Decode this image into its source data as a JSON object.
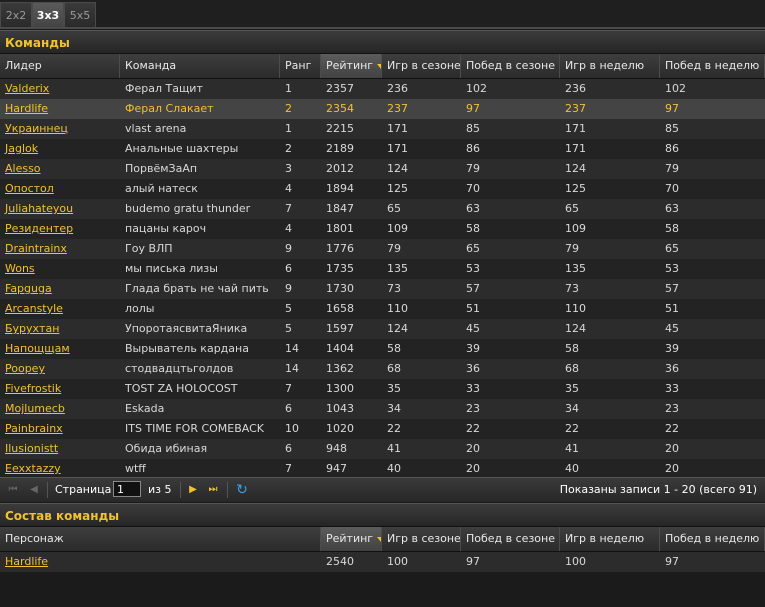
{
  "tabs": [
    "2x2",
    "3x3",
    "5x5"
  ],
  "teams_panel": {
    "title": "Команды",
    "columns": [
      "Лидер",
      "Команда",
      "Ранг",
      "Рейтинг",
      "Игр в сезоне",
      "Побед в сезоне",
      "Игр в неделю",
      "Побед в неделю"
    ],
    "rows": [
      [
        "Valderix",
        "Ферал Тащит",
        "1",
        "2357",
        "236",
        "102",
        "236",
        "102"
      ],
      [
        "Hardlife",
        "Ферал Слакает",
        "2",
        "2354",
        "237",
        "97",
        "237",
        "97"
      ],
      [
        "Украиннец",
        "vlast arena",
        "1",
        "2215",
        "171",
        "85",
        "171",
        "85"
      ],
      [
        "Jaglok",
        "Анальные шахтеры",
        "2",
        "2189",
        "171",
        "86",
        "171",
        "86"
      ],
      [
        "Alesso",
        "ПорвёмЗаАп",
        "3",
        "2012",
        "124",
        "79",
        "124",
        "79"
      ],
      [
        "Опостол",
        "алый натеск",
        "4",
        "1894",
        "125",
        "70",
        "125",
        "70"
      ],
      [
        "Juliahateyou",
        "budemo gratu thunder",
        "7",
        "1847",
        "65",
        "63",
        "65",
        "63"
      ],
      [
        "Резидентер",
        "пацаны кароч",
        "4",
        "1801",
        "109",
        "58",
        "109",
        "58"
      ],
      [
        "Draintrainx",
        "Гоу ВЛП",
        "9",
        "1776",
        "79",
        "65",
        "79",
        "65"
      ],
      [
        "Wons",
        "мы писька лизы",
        "6",
        "1735",
        "135",
        "53",
        "135",
        "53"
      ],
      [
        "Fapguga",
        "Глада брать не чай пить",
        "9",
        "1730",
        "73",
        "57",
        "73",
        "57"
      ],
      [
        "Arcanstyle",
        "лолы",
        "5",
        "1658",
        "110",
        "51",
        "110",
        "51"
      ],
      [
        "Бурухтан",
        "УпоротаясвитаЯника",
        "5",
        "1597",
        "124",
        "45",
        "124",
        "45"
      ],
      [
        "Напощщам",
        "Вырыватель кардана",
        "14",
        "1404",
        "58",
        "39",
        "58",
        "39"
      ],
      [
        "Poopey",
        "стодвадцтьголдов",
        "14",
        "1362",
        "68",
        "36",
        "68",
        "36"
      ],
      [
        "Fivefrostik",
        "TOST ZA HOLOCOST",
        "7",
        "1300",
        "35",
        "33",
        "35",
        "33"
      ],
      [
        "Mojlumecb",
        "Eskada",
        "6",
        "1043",
        "34",
        "23",
        "34",
        "23"
      ],
      [
        "Painbrainx",
        "ITS TIME FOR COMEBACK",
        "10",
        "1020",
        "22",
        "22",
        "22",
        "22"
      ],
      [
        "Ilusionistt",
        "Обида ибиная",
        "6",
        "948",
        "41",
        "20",
        "41",
        "20"
      ],
      [
        "Eexxtazzy",
        "wtff",
        "7",
        "947",
        "40",
        "20",
        "40",
        "20"
      ]
    ],
    "selected_row": 1
  },
  "pager": {
    "page_label": "Страница",
    "page_value": "1",
    "of_label": "из 5",
    "info": "Показаны записи 1 - 20 (всего 91)"
  },
  "roster_panel": {
    "title": "Состав команды",
    "columns": [
      "Персонаж",
      "Рейтинг",
      "Игр в сезоне",
      "Побед в сезоне",
      "Игр в неделю",
      "Побед в неделю"
    ],
    "rows": [
      [
        "Hardlife",
        "2540",
        "100",
        "97",
        "100",
        "97"
      ]
    ]
  },
  "colors": {
    "accent": "#f2c12e",
    "background": "#1b1b1b",
    "row_odd": "#2c2c2c",
    "row_even": "#232323",
    "row_selected": "#444444"
  },
  "icons": [
    "first-page-icon",
    "prev-page-icon",
    "next-page-icon",
    "last-page-icon",
    "refresh-icon",
    "sort-desc-icon"
  ]
}
